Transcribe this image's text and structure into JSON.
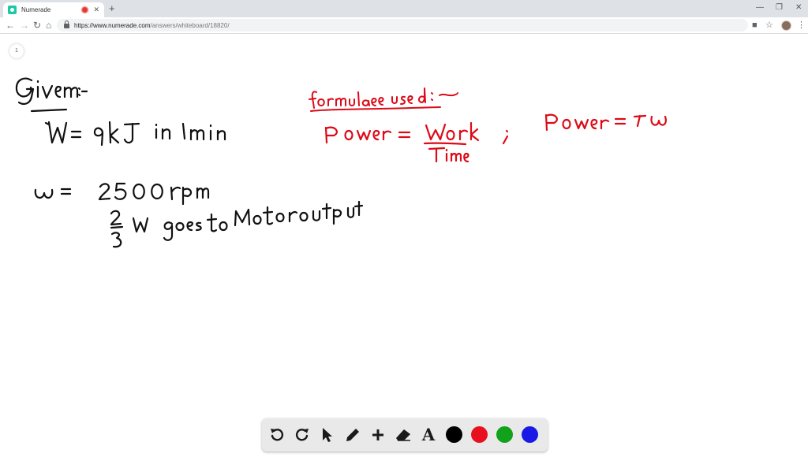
{
  "browser": {
    "tab_title": "Numerade",
    "tab_close": "✕",
    "new_tab": "+",
    "url_host": "https://www.numerade.com",
    "url_path": "/answers/whiteboard/18820/",
    "window_controls": [
      "—",
      "❐",
      "✕"
    ]
  },
  "board": {
    "page_number": "1",
    "lines": [
      "Given:-",
      "W = 9kJ in 1min",
      "ω = 2500 rpm",
      "2/3 W goes to Motor output",
      "formulae used:-",
      "Power = Work / Time",
      ";",
      "Power = τω"
    ]
  },
  "toolbar": {
    "tools": [
      "undo-icon",
      "redo-icon",
      "select-arrow-icon",
      "pen-icon",
      "add-icon",
      "eraser-icon",
      "text-tool-icon"
    ],
    "text_tool_label": "A",
    "colors": [
      "#000000",
      "#e8101f",
      "#12a11a",
      "#1a1ae6"
    ]
  }
}
